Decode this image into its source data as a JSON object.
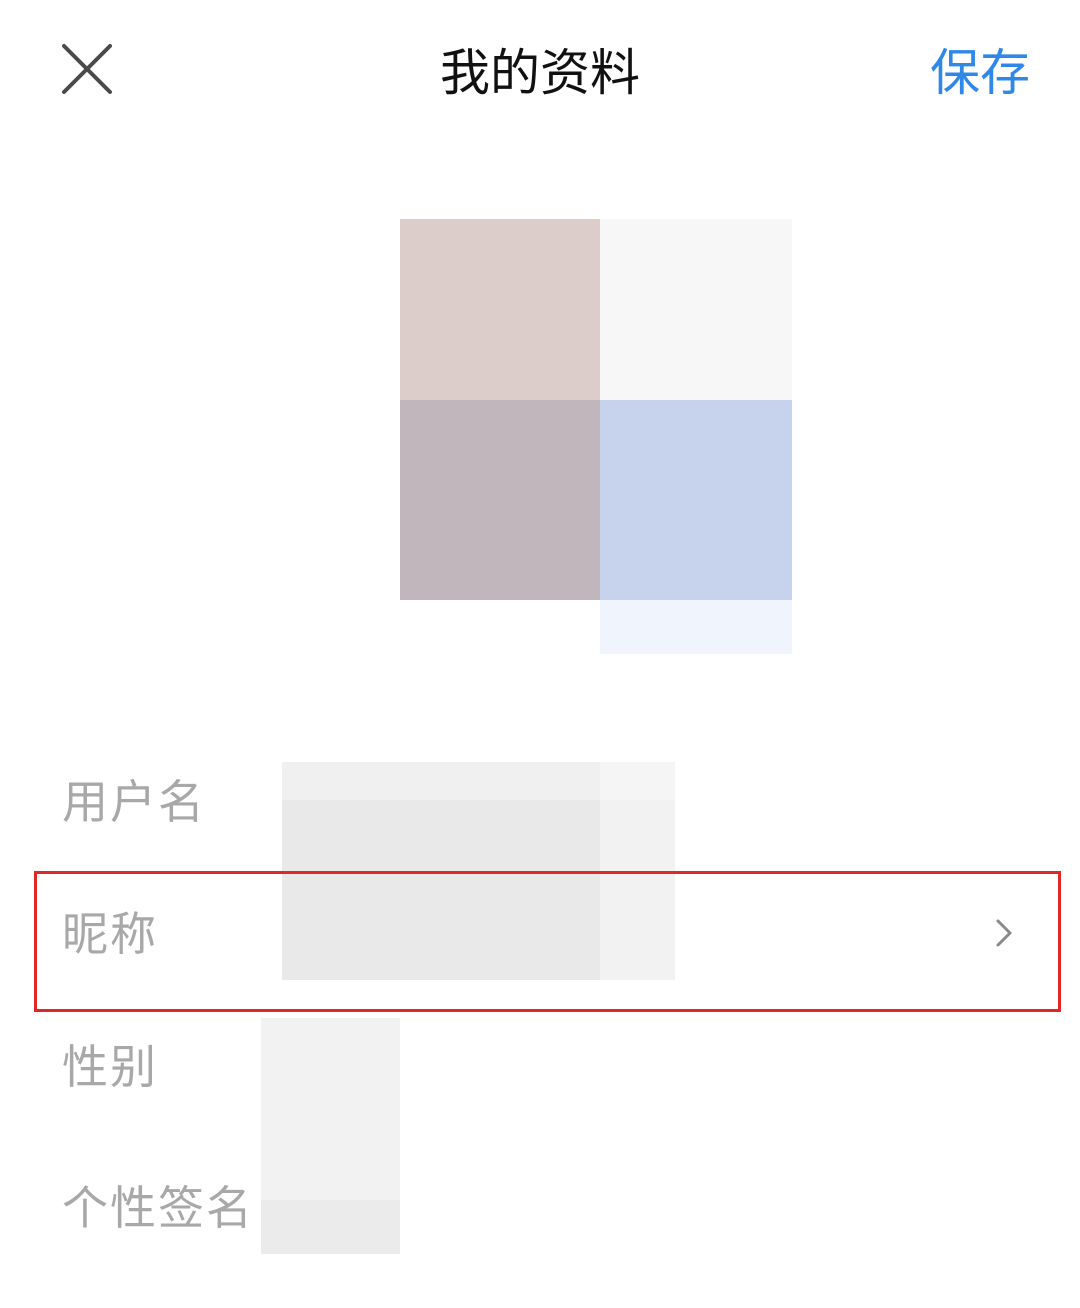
{
  "header": {
    "title": "我的资料",
    "save_label": "保存",
    "close_icon": "close-icon"
  },
  "avatar": {
    "icon": "avatar-image"
  },
  "form": {
    "username_label": "用户名",
    "nickname_label": "昵称",
    "gender_label": "性别",
    "signature_label": "个性签名"
  },
  "colors": {
    "accent": "#2f88e8",
    "label": "#a8a8a8",
    "highlight": "#e32626"
  }
}
